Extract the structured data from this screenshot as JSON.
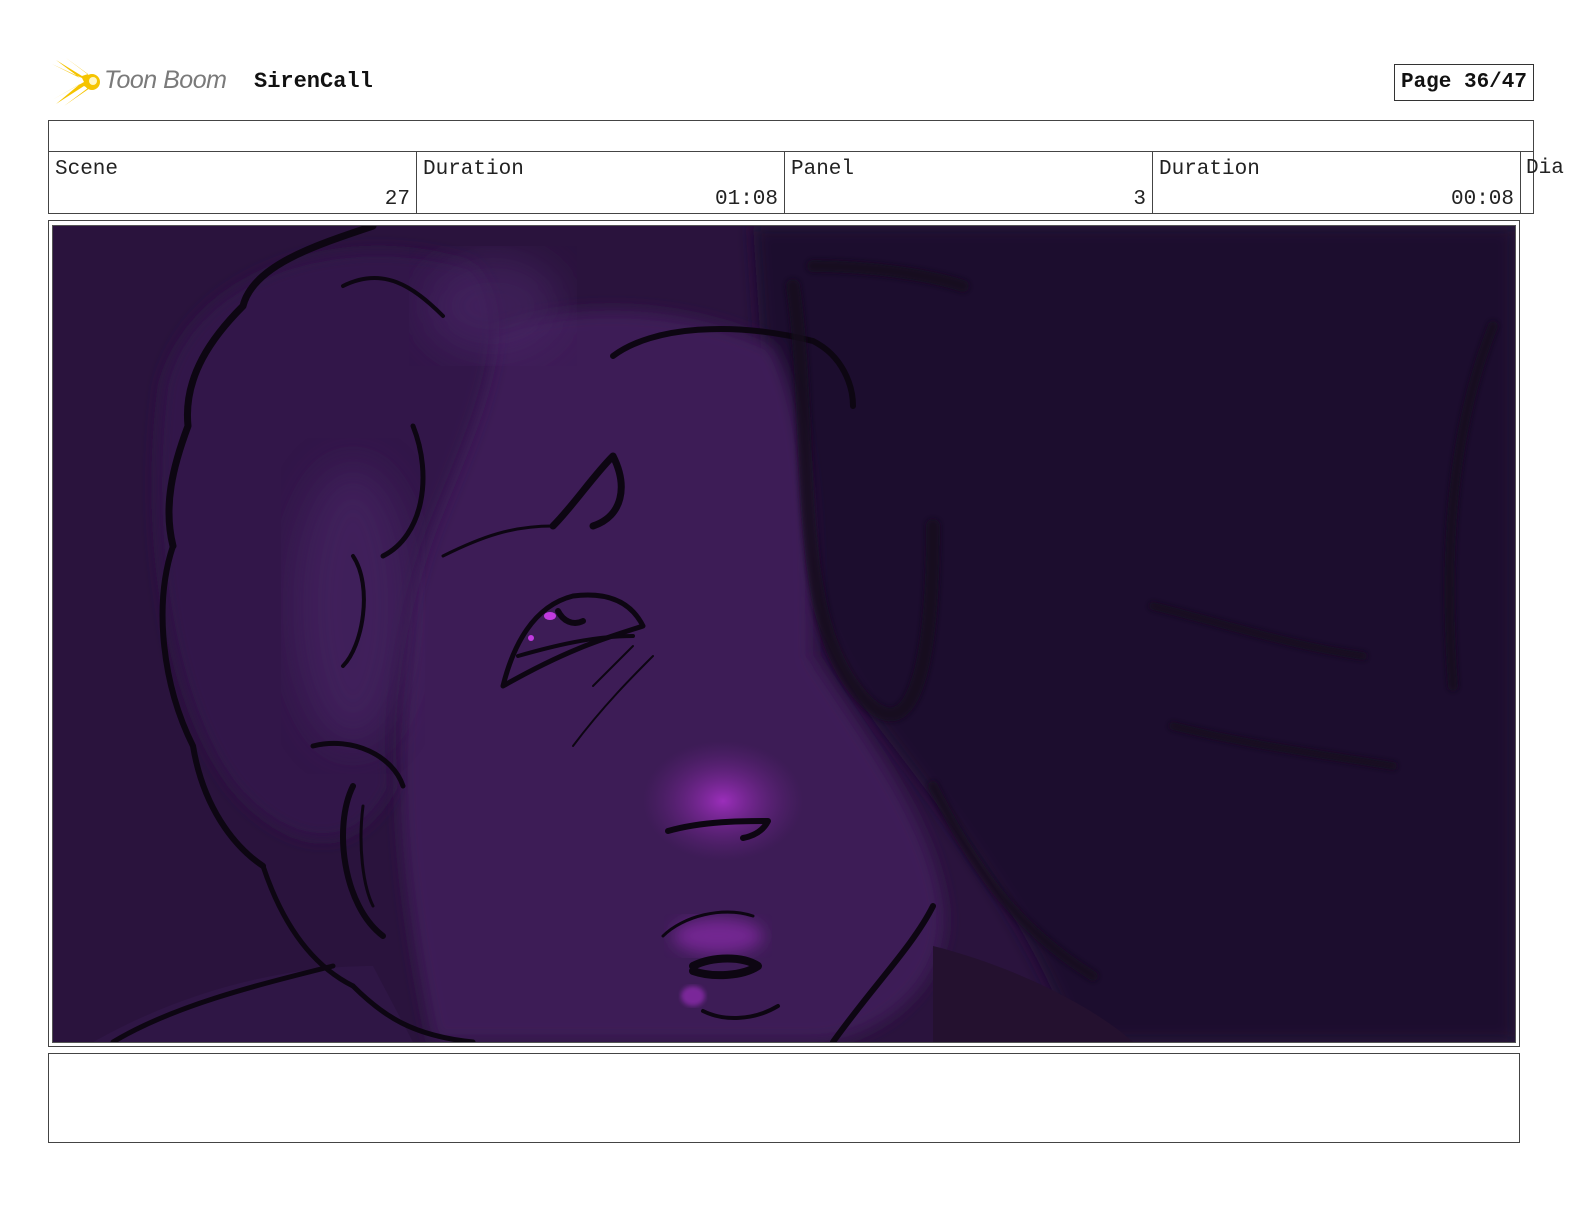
{
  "header": {
    "brand": "Toon Boom",
    "project": "SirenCall",
    "page": "Page 36/47"
  },
  "info": {
    "scene_label": "Scene",
    "scene_value": "27",
    "scene_duration_label": "Duration",
    "scene_duration_value": "01:08",
    "panel_label": "Panel",
    "panel_value": "3",
    "panel_duration_label": "Duration",
    "panel_duration_value": "00:08",
    "dialog_label": "Dia"
  },
  "notes": {
    "text": ""
  },
  "colors": {
    "panel_background": "#2a133d",
    "face": "#3e1f57",
    "hair_shadow": "#1f0f2e",
    "highlight": "#9b2bb8",
    "sketch_line": "#0d0612",
    "logo_yellow": "#f5c400"
  },
  "icons": {
    "logo": "starburst-icon"
  }
}
